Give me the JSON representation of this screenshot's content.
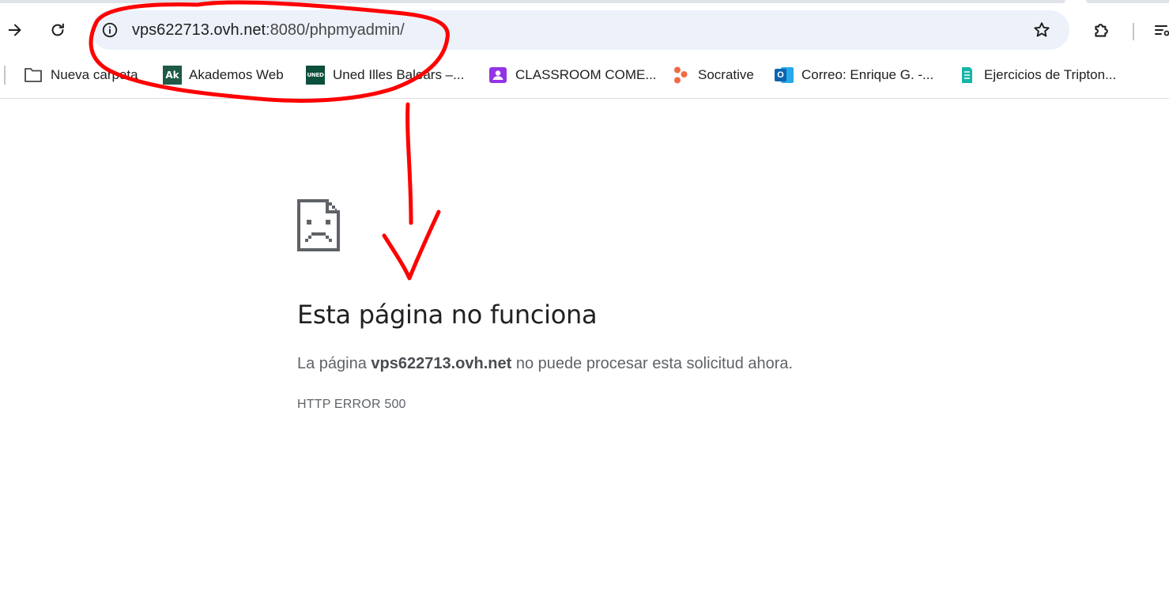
{
  "toolbar": {
    "address_host": "vps622713.ovh.net",
    "address_rest": ":8080/phpmyadmin/"
  },
  "bookmarks": [
    {
      "label": "Nueva carpeta",
      "icon": "folder-icon"
    },
    {
      "label": "Akademos Web",
      "icon": "akademos-icon",
      "badge": "Ak"
    },
    {
      "label": "Uned Illes Balears –...",
      "icon": "uned-icon",
      "badge": "UNED"
    },
    {
      "label": "CLASSROOM COME...",
      "icon": "classroom-icon"
    },
    {
      "label": "Socrative",
      "icon": "socrative-icon"
    },
    {
      "label": "Correo: Enrique G. -...",
      "icon": "outlook-icon",
      "badge": "O"
    },
    {
      "label": "Ejercicios de Tripton...",
      "icon": "tripton-icon"
    }
  ],
  "error": {
    "title": "Esta página no funciona",
    "message_prefix": "La página ",
    "message_host": "vps622713.ovh.net",
    "message_suffix": " no puede procesar esta solicitud ahora.",
    "code": "HTTP ERROR 500"
  },
  "colors": {
    "omnibox_bg": "#edf2fa",
    "annotation_red": "#ff0000",
    "error_text": "#5f6368"
  }
}
